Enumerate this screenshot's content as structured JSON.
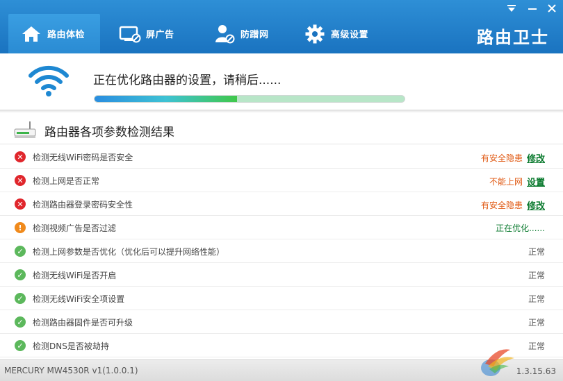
{
  "window": {
    "brand": "路由卫士",
    "controls": {
      "menu": "▾",
      "minimize": "–",
      "close": "×"
    }
  },
  "tabs": [
    {
      "label": "路由体检",
      "icon": "home-icon",
      "active": true
    },
    {
      "label": "屏广告",
      "icon": "screen-block-icon",
      "active": false
    },
    {
      "label": "防蹭网",
      "icon": "user-block-icon",
      "active": false
    },
    {
      "label": "高级设置",
      "icon": "gear-icon",
      "active": false
    }
  ],
  "progress": {
    "status_text": "正在优化路由器的设置，请稍后......",
    "percent": 46,
    "colors": {
      "fill_start": "#2a8de0",
      "fill_end": "#40c84a",
      "track": "#b8e6c8"
    }
  },
  "results": {
    "title": "路由器各项参数检测结果",
    "items": [
      {
        "label": "检测无线WiFi密码是否安全",
        "status": "fail",
        "result_text": "有安全隐患",
        "action": "修改"
      },
      {
        "label": "检测上网是否正常",
        "status": "fail",
        "result_text": "不能上网",
        "action": "设置"
      },
      {
        "label": "检测路由器登录密码安全性",
        "status": "fail",
        "result_text": "有安全隐患",
        "action": "修改"
      },
      {
        "label": "检测视频广告是否过滤",
        "status": "warn",
        "result_text": "正在优化......",
        "action": ""
      },
      {
        "label": "检测上网参数是否优化（优化后可以提升网络性能）",
        "status": "ok",
        "result_text": "正常",
        "action": ""
      },
      {
        "label": "检测无线WiFi是否开启",
        "status": "ok",
        "result_text": "正常",
        "action": ""
      },
      {
        "label": "检测无线WiFi安全项设置",
        "status": "ok",
        "result_text": "正常",
        "action": ""
      },
      {
        "label": "检测路由器固件是否可升级",
        "status": "ok",
        "result_text": "正常",
        "action": ""
      },
      {
        "label": "检测DNS是否被劫持",
        "status": "ok",
        "result_text": "正常",
        "action": ""
      }
    ]
  },
  "footer": {
    "model": "MERCURY MW4530R v1(1.0.0.1)",
    "version": "1.3.15.63"
  },
  "colors": {
    "header_blue": "#1a73c0",
    "fail_red": "#e0262c",
    "warn_orange": "#f08a1c",
    "ok_green": "#5cb85c",
    "link_green": "#0a7a2e",
    "warn_text": "#e05a14"
  }
}
